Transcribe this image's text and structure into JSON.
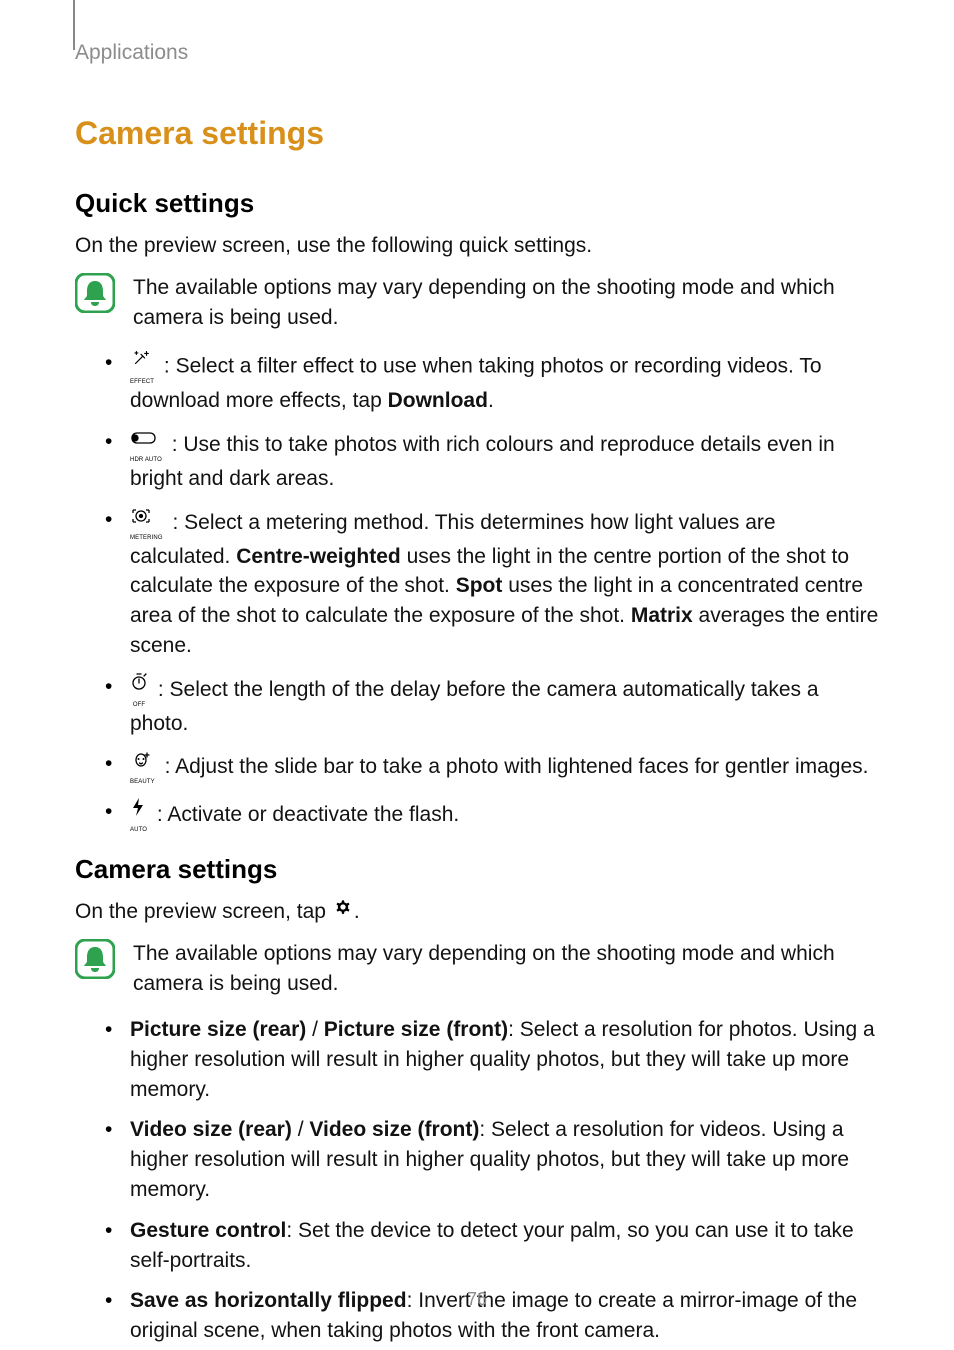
{
  "header": {
    "breadcrumb": "Applications"
  },
  "section": {
    "title": "Camera settings"
  },
  "quick": {
    "heading": "Quick settings",
    "intro": "On the preview screen, use the following quick settings.",
    "note": "The available options may vary depending on the shooting mode and which camera is being used.",
    "items": {
      "filter": {
        "icon_label": "EFFECT",
        "b1": "",
        "t1": " : Select a filter effect to use when taking photos or recording videos. To download more effects, tap ",
        "b2": "Download",
        "t2": "."
      },
      "hdr": {
        "icon_label": "HDR AUTO",
        "t1": " : Use this to take photos with rich colours and reproduce details even in bright and dark areas."
      },
      "metering": {
        "icon_label": "METERING",
        "t1": " : Select a metering method. This determines how light values are calculated. ",
        "b1": "Centre-weighted",
        "t2": " uses the light in the centre portion of the shot to calculate the exposure of the shot. ",
        "b2": "Spot",
        "t3": " uses the light in a concentrated centre area of the shot to calculate the exposure of the shot. ",
        "b3": "Matrix",
        "t4": " averages the entire scene."
      },
      "timer": {
        "icon_label": "OFF",
        "t1": " : Select the length of the delay before the camera automatically takes a photo."
      },
      "beauty": {
        "icon_label": "BEAUTY",
        "t1": " : Adjust the slide bar to take a photo with lightened faces for gentler images."
      },
      "flash": {
        "icon_label": "AUTO",
        "t1": " : Activate or deactivate the flash."
      }
    }
  },
  "cam": {
    "heading": "Camera settings",
    "intro_pre": "On the preview screen, tap ",
    "intro_post": ".",
    "note": "The available options may vary depending on the shooting mode and which camera is being used.",
    "items": {
      "picture": {
        "b1": "Picture size (rear)",
        "sep": " / ",
        "b2": "Picture size (front)",
        "t1": ": Select a resolution for photos. Using a higher resolution will result in higher quality photos, but they will take up more memory."
      },
      "video": {
        "b1": "Video size (rear)",
        "sep": " / ",
        "b2": "Video size (front)",
        "t1": ": Select a resolution for videos. Using a higher resolution will result in higher quality photos, but they will take up more memory."
      },
      "gesture": {
        "b1": "Gesture control",
        "t1": ": Set the device to detect your palm, so you can use it to take self-portraits."
      },
      "flip": {
        "b1": "Save as horizontally flipped",
        "t1": ": Invert the image to create a mirror-image of the original scene, when taking photos with the front camera."
      }
    }
  },
  "page_number": "76"
}
